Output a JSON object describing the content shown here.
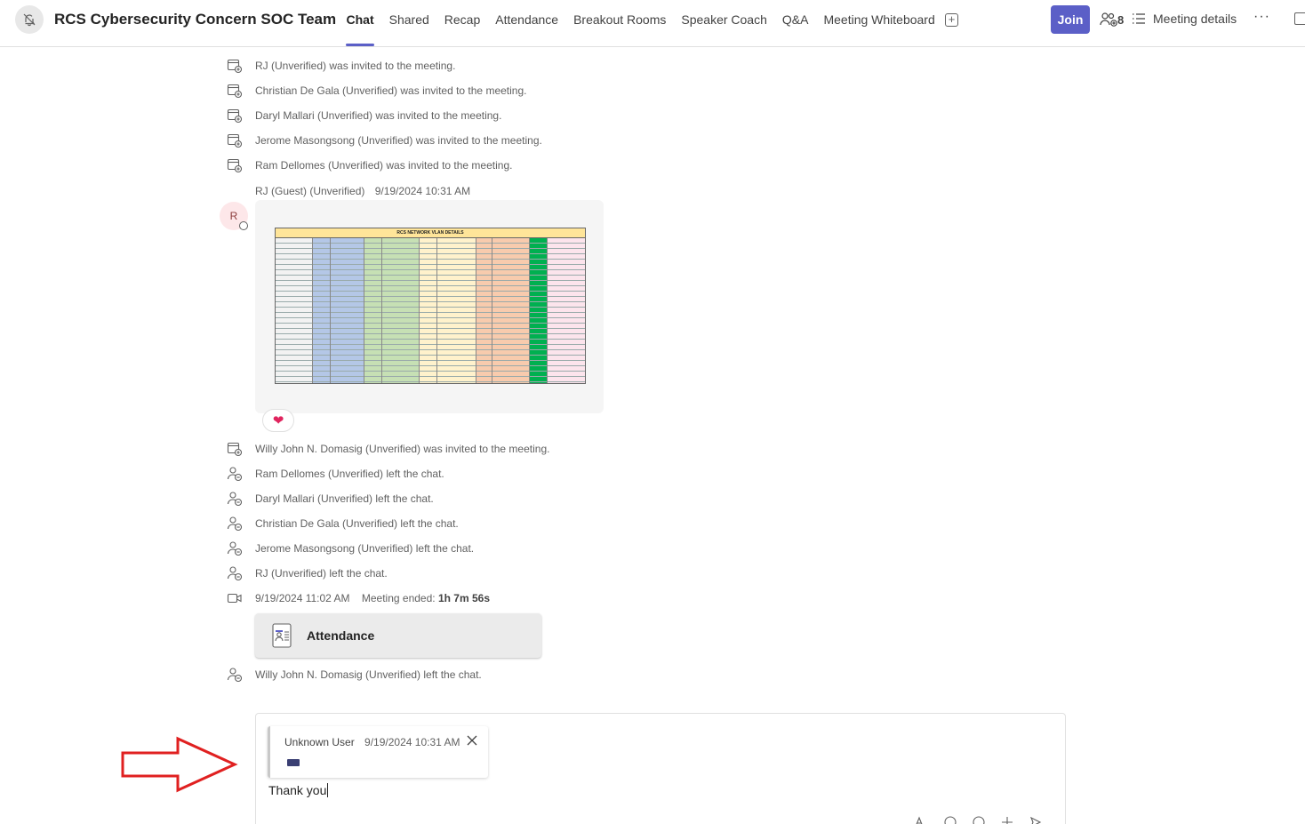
{
  "header": {
    "title": "RCS Cybersecurity Concern SOC Team",
    "tabs": [
      "Chat",
      "Shared",
      "Recap",
      "Attendance",
      "Breakout Rooms",
      "Speaker Coach",
      "Q&A",
      "Meeting Whiteboard"
    ],
    "active_tab": "Chat",
    "join_label": "Join",
    "people_count": "8",
    "details_label": "Meeting details",
    "more_label": "···"
  },
  "events_top": [
    "RJ (Unverified) was invited to the meeting.",
    "Christian De Gala (Unverified) was invited to the meeting.",
    "Daryl Mallari (Unverified) was invited to the meeting.",
    "Jerome Masongsong (Unverified) was invited to the meeting.",
    "Ram Dellomes (Unverified) was invited to the meeting."
  ],
  "message": {
    "author": "RJ (Guest) (Unverified)",
    "timestamp": "9/19/2024 10:31 AM",
    "avatar_initial": "R",
    "image_title": "RCS NETWORK VLAN DETAILS",
    "reaction": "❤"
  },
  "events_bottom": [
    "Willy John N. Domasig (Unverified) was invited to the meeting.",
    "Ram Dellomes (Unverified) left the chat.",
    "Daryl Mallari (Unverified) left the chat.",
    "Christian De Gala (Unverified) left the chat.",
    "Jerome Masongsong (Unverified) left the chat.",
    "RJ (Unverified) left the chat."
  ],
  "meeting_end": {
    "timestamp": "9/19/2024 11:02 AM",
    "label": "Meeting ended:",
    "duration": "1h 7m 56s"
  },
  "attendance_card": {
    "label": "Attendance"
  },
  "event_last": "Willy John N. Domasig (Unverified) left the chat.",
  "compose": {
    "quote_author": "Unknown User",
    "quote_timestamp": "9/19/2024 10:31 AM",
    "text": "Thank you"
  },
  "colors": {
    "accent": "#5b5fc7",
    "arrow": "#e02020"
  }
}
